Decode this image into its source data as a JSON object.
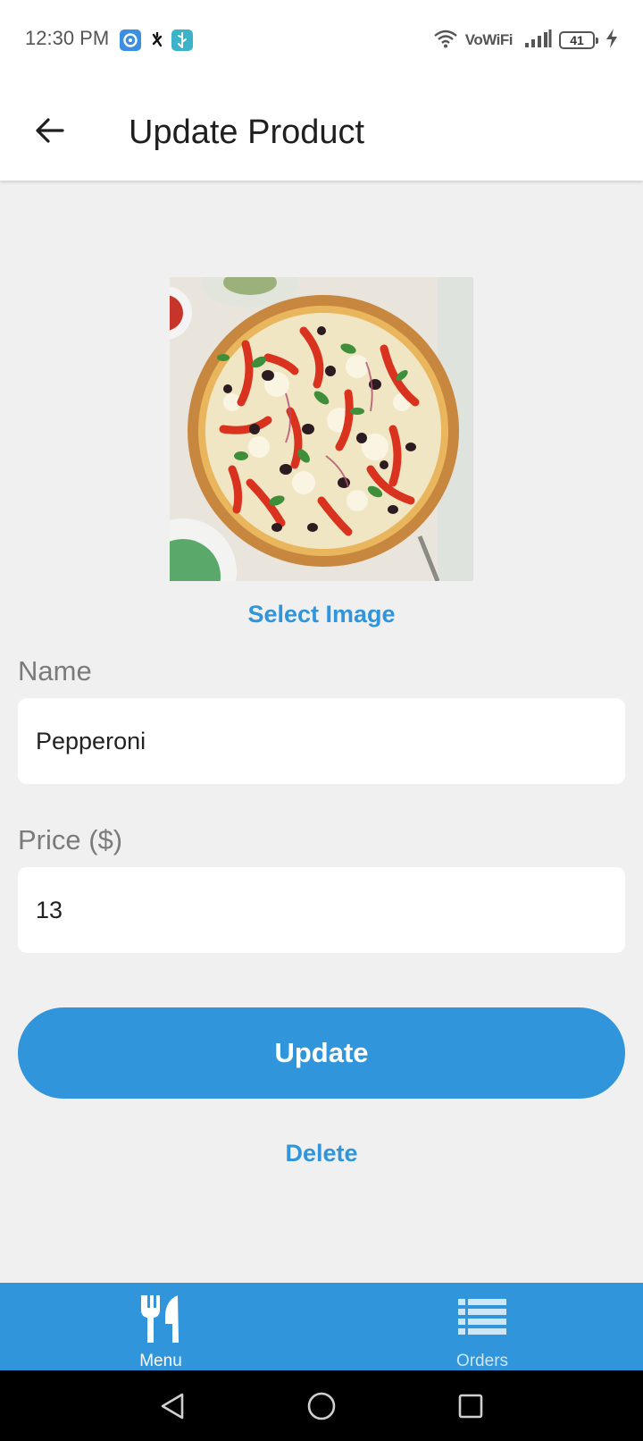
{
  "status_bar": {
    "time": "12:30 PM",
    "network_label": "VoWiFi",
    "battery_level": "41",
    "icons": [
      "settings-gear-icon",
      "bug-icon",
      "usb-icon",
      "wifi-icon",
      "signal-icon",
      "battery-icon",
      "charging-icon"
    ]
  },
  "header": {
    "title": "Update Product",
    "back_icon": "arrow-left-icon"
  },
  "product": {
    "image_subject": "pizza",
    "select_image_label": "Select Image"
  },
  "form": {
    "name_label": "Name",
    "name_value": "Pepperoni",
    "price_label": "Price ($)",
    "price_value": "13"
  },
  "actions": {
    "update_label": "Update",
    "delete_label": "Delete"
  },
  "bottom_nav": {
    "items": [
      {
        "label": "Menu",
        "icon": "fork-knife-icon",
        "active": true
      },
      {
        "label": "Orders",
        "icon": "list-icon",
        "active": false
      }
    ]
  },
  "system_nav": [
    "back-triangle-icon",
    "home-circle-icon",
    "recents-square-icon"
  ],
  "colors": {
    "accent": "#3095db",
    "background": "#f0f0f0",
    "surface": "#ffffff"
  }
}
